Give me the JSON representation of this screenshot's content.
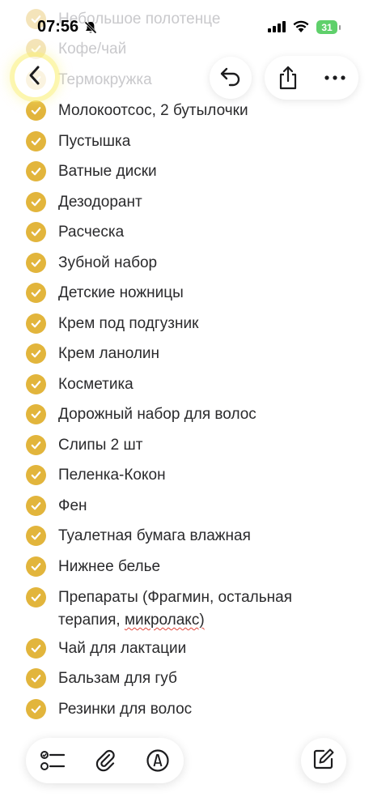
{
  "status_bar": {
    "time": "07:56",
    "battery": "31"
  },
  "checklist": [
    {
      "text": "Небольшое полотенце",
      "faded": true
    },
    {
      "text": "Кофе/чай",
      "faded": true
    },
    {
      "text": "Термокружка",
      "faded": true
    },
    {
      "text": "Молокоотсос, 2 бутылочки"
    },
    {
      "text": "Пустышка"
    },
    {
      "text": "Ватные диски"
    },
    {
      "text": "Дезодорант"
    },
    {
      "text": "Расческа"
    },
    {
      "text": "Зубной набор"
    },
    {
      "text": "Детские ножницы"
    },
    {
      "text": "Крем под подгузник"
    },
    {
      "text": "Крем ланолин"
    },
    {
      "text": "Косметика"
    },
    {
      "text": "Дорожный набор для волос"
    },
    {
      "text": "Слипы 2 шт"
    },
    {
      "text": "Пеленка-Кокон"
    },
    {
      "text": "Фен"
    },
    {
      "text": "Туалетная бумага влажная"
    },
    {
      "text": "Нижнее белье"
    },
    {
      "text": "Препараты (Фрагмин, остальная терапия,",
      "text2": "микролакс)"
    },
    {
      "text": "Чай для лактации"
    },
    {
      "text": "Бальзам для губ"
    },
    {
      "text": "Резинки для волос"
    }
  ],
  "icons": {
    "back": "chevron-left-icon",
    "undo": "undo-icon",
    "share": "share-icon",
    "more": "more-icon",
    "checklist": "checklist-icon",
    "attach": "paperclip-icon",
    "markup": "pen-markup-icon",
    "compose": "compose-icon"
  },
  "colors": {
    "check": "#e2b53c",
    "battery": "#5fd06b",
    "spellcheck": "#e0453a"
  }
}
